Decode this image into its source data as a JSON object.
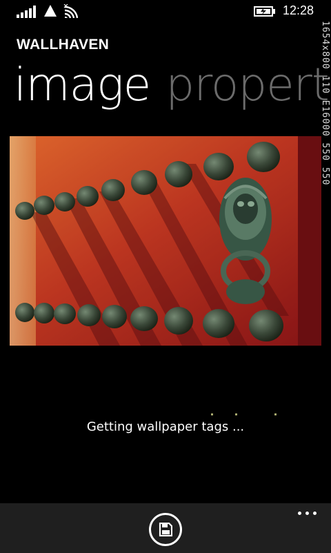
{
  "status_bar": {
    "time": "12:28",
    "icons": [
      "signal-icon",
      "triangle-icon",
      "wifi-icon",
      "battery-charging-icon"
    ]
  },
  "app": {
    "title": "WALLHAVEN"
  },
  "pivot": {
    "active": "image",
    "next": "propert"
  },
  "side_text": "1654x800 110 E16000 550 550",
  "content": {
    "image_icon": "wallpaper-image",
    "loading_text": "Getting wallpaper tags ..."
  },
  "app_bar": {
    "save_icon": "save-icon",
    "more_icon": "more-icon"
  },
  "colors": {
    "background": "#000000",
    "app_bar": "#1f1f1f",
    "pivot_inactive": "#6b6b6b",
    "loading_dots": "#a6a86d"
  }
}
